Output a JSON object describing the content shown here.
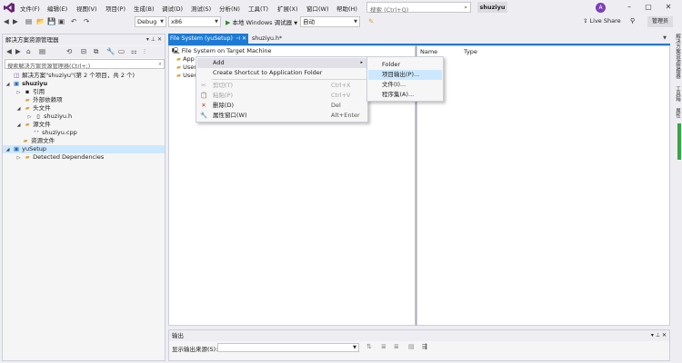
{
  "menubar": {
    "items": [
      "文件(F)",
      "编辑(E)",
      "视图(V)",
      "项目(P)",
      "生成(B)",
      "调试(D)",
      "测试(S)",
      "分析(N)",
      "工具(T)",
      "扩展(X)",
      "窗口(W)",
      "帮助(H)"
    ],
    "search_placeholder": "搜索 (Ctrl+Q)",
    "solution_name": "shuziyu",
    "avatar_letter": "A"
  },
  "toolbar": {
    "config": "Debug",
    "platform": "x86",
    "run_label": "本地 Windows 调试器",
    "run_mode": "自动",
    "live_share": "Live Share",
    "admin": "管理员"
  },
  "solution_explorer": {
    "title": "解决方案资源管理器",
    "search_placeholder": "搜索解决方案资源管理器(Ctrl+;)",
    "tree": [
      {
        "label": "解决方案\"shuziyu\"(第 2 个项目，共 2 个)",
        "icon": "solution-icon"
      },
      {
        "label": "shuziyu",
        "icon": "cpp-project-icon",
        "bold": true
      },
      {
        "label": "引用",
        "icon": "references-icon"
      },
      {
        "label": "外部依赖项",
        "icon": "external-deps-icon"
      },
      {
        "label": "头文件",
        "icon": "folder-icon"
      },
      {
        "label": "shuziyu.h",
        "icon": "header-file-icon"
      },
      {
        "label": "源文件",
        "icon": "folder-icon"
      },
      {
        "label": "shuziyu.cpp",
        "icon": "cpp-file-icon"
      },
      {
        "label": "资源文件",
        "icon": "folder-icon"
      },
      {
        "label": "yuSetup",
        "icon": "setup-project-icon"
      },
      {
        "label": "Detected Dependencies",
        "icon": "folder-icon"
      }
    ]
  },
  "tabs": {
    "active": "File System (yuSetup)",
    "inactive": "shuziyu.h*"
  },
  "file_system": {
    "root": "File System on Target Machine",
    "items": [
      "App",
      "User",
      "User"
    ],
    "columns": [
      "Name",
      "Type"
    ]
  },
  "context_menu": {
    "items": [
      {
        "label": "Add",
        "shortcut": "",
        "has_submenu": true
      },
      {
        "label": "Create Shortcut to Application Folder",
        "shortcut": ""
      },
      {
        "label": "剪切(T)",
        "shortcut": "Ctrl+X",
        "disabled": true
      },
      {
        "label": "粘贴(P)",
        "shortcut": "Ctrl+V",
        "disabled": true
      },
      {
        "label": "删除(D)",
        "shortcut": "Del"
      },
      {
        "label": "属性窗口(W)",
        "shortcut": "Alt+Enter"
      }
    ]
  },
  "submenu": {
    "items": [
      "Folder",
      "项目输出(P)...",
      "文件(I)...",
      "程序集(A)..."
    ]
  },
  "output": {
    "title": "输出",
    "source_label": "显示输出来源(S):",
    "source_value": ""
  },
  "side_tabs": [
    "解决方案资源管理器",
    "工具箱",
    "属性"
  ],
  "colors": {
    "accent": "#1e7bd4",
    "selection": "#cce8ff",
    "avatar": "#7b3fb8",
    "status_green": "#3aa34a"
  }
}
